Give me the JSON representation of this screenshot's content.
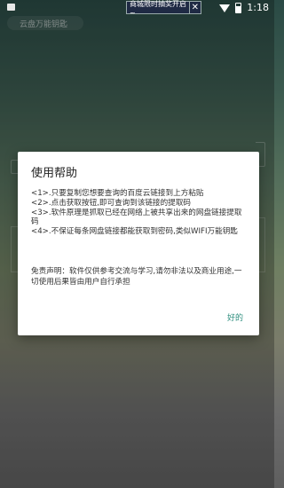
{
  "status_bar": {
    "time": "1:18",
    "ad_text": "商城限时抽奖开启~",
    "ad_close": "✕"
  },
  "app": {
    "title": "云盘万能钥匙"
  },
  "dialog": {
    "title": "使用帮助",
    "lines": [
      "<1>.只要复制您想要查询的百度云链接到上方粘贴",
      "<2>.点击获取按钮,即可查询到该链接的提取码",
      "<3>.软件原理是抓取已经在网络上被共享出来的网盘链接提取码",
      "<4>.不保证每条网盘链接都能获取到密码,类似WIFI万能钥匙"
    ],
    "disclaimer": "免责声明：软件仅供参考交流与学习,请勿非法以及商业用途,一切使用后果皆由用户自行承担",
    "ok_label": "好的"
  },
  "colors": {
    "accent": "#2f8f7f",
    "dialog_bg": "#ffffff"
  }
}
